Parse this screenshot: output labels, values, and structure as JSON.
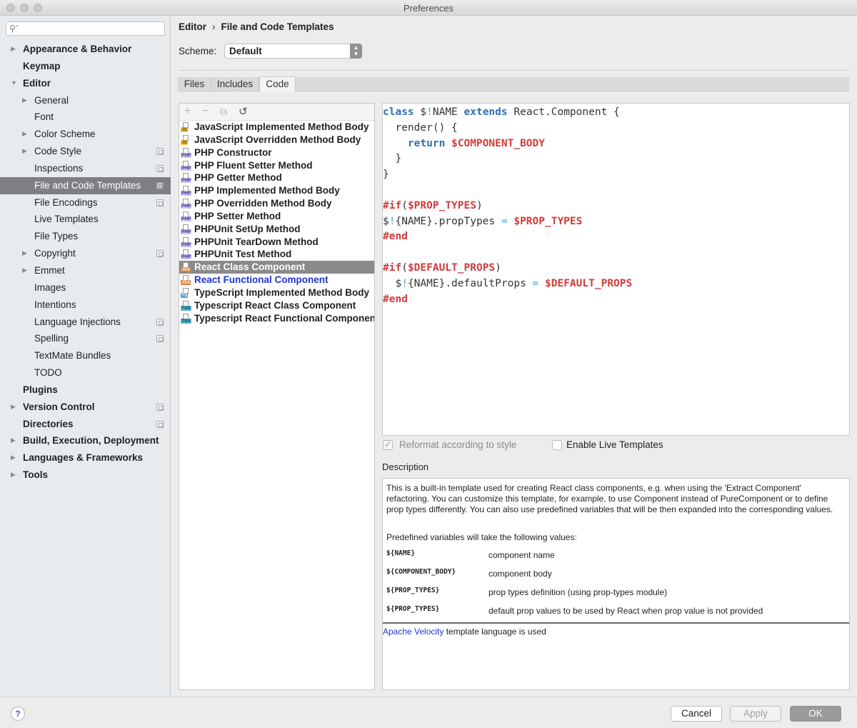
{
  "window": {
    "title": "Preferences"
  },
  "search": {
    "placeholder": ""
  },
  "sidebar": {
    "items": [
      {
        "label": "Appearance & Behavior",
        "bold": true,
        "arrow": "right",
        "level": 0,
        "badge": false
      },
      {
        "label": "Keymap",
        "bold": true,
        "arrow": "",
        "level": 0,
        "badge": false
      },
      {
        "label": "Editor",
        "bold": true,
        "arrow": "down",
        "level": 0,
        "badge": false
      },
      {
        "label": "General",
        "bold": false,
        "arrow": "right",
        "level": 1,
        "badge": false
      },
      {
        "label": "Font",
        "bold": false,
        "arrow": "",
        "level": 1,
        "badge": false
      },
      {
        "label": "Color Scheme",
        "bold": false,
        "arrow": "right",
        "level": 1,
        "badge": false
      },
      {
        "label": "Code Style",
        "bold": false,
        "arrow": "right",
        "level": 1,
        "badge": true
      },
      {
        "label": "Inspections",
        "bold": false,
        "arrow": "",
        "level": 1,
        "badge": true
      },
      {
        "label": "File and Code Templates",
        "bold": false,
        "arrow": "",
        "level": 1,
        "badge": true,
        "selected": true
      },
      {
        "label": "File Encodings",
        "bold": false,
        "arrow": "",
        "level": 1,
        "badge": true
      },
      {
        "label": "Live Templates",
        "bold": false,
        "arrow": "",
        "level": 1,
        "badge": false
      },
      {
        "label": "File Types",
        "bold": false,
        "arrow": "",
        "level": 1,
        "badge": false
      },
      {
        "label": "Copyright",
        "bold": false,
        "arrow": "right",
        "level": 1,
        "badge": true
      },
      {
        "label": "Emmet",
        "bold": false,
        "arrow": "right",
        "level": 1,
        "badge": false
      },
      {
        "label": "Images",
        "bold": false,
        "arrow": "",
        "level": 1,
        "badge": false
      },
      {
        "label": "Intentions",
        "bold": false,
        "arrow": "",
        "level": 1,
        "badge": false
      },
      {
        "label": "Language Injections",
        "bold": false,
        "arrow": "",
        "level": 1,
        "badge": true
      },
      {
        "label": "Spelling",
        "bold": false,
        "arrow": "",
        "level": 1,
        "badge": true
      },
      {
        "label": "TextMate Bundles",
        "bold": false,
        "arrow": "",
        "level": 1,
        "badge": false
      },
      {
        "label": "TODO",
        "bold": false,
        "arrow": "",
        "level": 1,
        "badge": false
      },
      {
        "label": "Plugins",
        "bold": true,
        "arrow": "",
        "level": 0,
        "badge": false
      },
      {
        "label": "Version Control",
        "bold": true,
        "arrow": "right",
        "level": 0,
        "badge": true
      },
      {
        "label": "Directories",
        "bold": true,
        "arrow": "",
        "level": 0,
        "badge": true
      },
      {
        "label": "Build, Execution, Deployment",
        "bold": true,
        "arrow": "right",
        "level": 0,
        "badge": false
      },
      {
        "label": "Languages & Frameworks",
        "bold": true,
        "arrow": "right",
        "level": 0,
        "badge": false
      },
      {
        "label": "Tools",
        "bold": true,
        "arrow": "right",
        "level": 0,
        "badge": false
      }
    ]
  },
  "breadcrumb": {
    "parent": "Editor",
    "separator": "›",
    "current": "File and Code Templates"
  },
  "scheme": {
    "label": "Scheme:",
    "value": "Default"
  },
  "tabs": [
    {
      "label": "Files",
      "active": false
    },
    {
      "label": "Includes",
      "active": false
    },
    {
      "label": "Code",
      "active": true
    }
  ],
  "toolbar": {
    "add": "+",
    "remove": "−",
    "copy": "⧉",
    "reset": "↺"
  },
  "templates": [
    {
      "label": "JavaScript Implemented Method Body",
      "tag": "JS"
    },
    {
      "label": "JavaScript Overridden Method Body",
      "tag": "JS"
    },
    {
      "label": "PHP Constructor",
      "tag": "PHP"
    },
    {
      "label": "PHP Fluent Setter Method",
      "tag": "PHP"
    },
    {
      "label": "PHP Getter Method",
      "tag": "PHP"
    },
    {
      "label": "PHP Implemented Method Body",
      "tag": "PHP"
    },
    {
      "label": "PHP Overridden Method Body",
      "tag": "PHP"
    },
    {
      "label": "PHP Setter Method",
      "tag": "PHP"
    },
    {
      "label": "PHPUnit SetUp Method",
      "tag": "PHP"
    },
    {
      "label": "PHPUnit TearDown Method",
      "tag": "PHP"
    },
    {
      "label": "PHPUnit Test Method",
      "tag": "PHP"
    },
    {
      "label": "React Class Component",
      "tag": "JSX",
      "selected": true
    },
    {
      "label": "React Functional Component",
      "tag": "JSX",
      "blue": true
    },
    {
      "label": "TypeScript Implemented Method Body",
      "tag": "TS"
    },
    {
      "label": "Typescript React Class Component",
      "tag": "TSX"
    },
    {
      "label": "Typescript React Functional Component",
      "tag": "TSX"
    }
  ],
  "code": {
    "lines": [
      [
        [
          "kw",
          "class"
        ],
        [
          "t",
          " $"
        ],
        [
          "op",
          "!"
        ],
        [
          "t",
          "NAME "
        ],
        [
          "kw",
          "extends"
        ],
        [
          "t",
          " React.Component {"
        ]
      ],
      [
        [
          "t",
          "  render() {"
        ]
      ],
      [
        [
          "t",
          "    "
        ],
        [
          "kw",
          "return"
        ],
        [
          "t",
          " "
        ],
        [
          "var",
          "$COMPONENT_BODY"
        ]
      ],
      [
        [
          "t",
          "  }"
        ]
      ],
      [
        [
          "t",
          "}"
        ]
      ],
      [
        [
          "t",
          ""
        ]
      ],
      [
        [
          "dir",
          "#if"
        ],
        [
          "t",
          "("
        ],
        [
          "var",
          "$PROP_TYPES"
        ],
        [
          "t",
          ")"
        ]
      ],
      [
        [
          "t",
          "$"
        ],
        [
          "op",
          "!"
        ],
        [
          "t",
          "{NAME}.propTypes "
        ],
        [
          "op",
          "="
        ],
        [
          "t",
          " "
        ],
        [
          "var",
          "$PROP_TYPES"
        ]
      ],
      [
        [
          "dir",
          "#end"
        ]
      ],
      [
        [
          "t",
          ""
        ]
      ],
      [
        [
          "dir",
          "#if"
        ],
        [
          "t",
          "("
        ],
        [
          "var",
          "$DEFAULT_PROPS"
        ],
        [
          "t",
          ")"
        ]
      ],
      [
        [
          "t",
          "  $"
        ],
        [
          "op",
          "!"
        ],
        [
          "t",
          "{NAME}.defaultProps "
        ],
        [
          "op",
          "="
        ],
        [
          "t",
          " "
        ],
        [
          "var",
          "$DEFAULT_PROPS"
        ]
      ],
      [
        [
          "dir",
          "#end"
        ]
      ]
    ]
  },
  "options": {
    "reformat": {
      "label": "Reformat according to style",
      "checked": true,
      "enabled": false
    },
    "live_templates": {
      "label": "Enable Live Templates",
      "checked": false
    }
  },
  "description": {
    "label": "Description",
    "body": "This is a built-in template used for creating React class components, e.g. when using the 'Extract Component' refactoring. You can customize this template, for example, to use Component instead of PureComponent or to define prop types differently. You can also use predefined variables that will be then expanded into the corresponding values.",
    "predefined": "Predefined variables will take the following values:",
    "variables": [
      {
        "name": "${NAME}",
        "desc": "component name"
      },
      {
        "name": "${COMPONENT_BODY}",
        "desc": "component body"
      },
      {
        "name": "${PROP_TYPES}",
        "desc": "prop types definition (using prop-types module)"
      },
      {
        "name": "${PROP_TYPES}",
        "desc": "default prop values to be used by React when prop value is not provided"
      }
    ],
    "footer_link": "Apache Velocity",
    "footer_text": " template language is used"
  },
  "buttons": {
    "help": "?",
    "cancel": "Cancel",
    "apply": "Apply",
    "ok": "OK"
  }
}
